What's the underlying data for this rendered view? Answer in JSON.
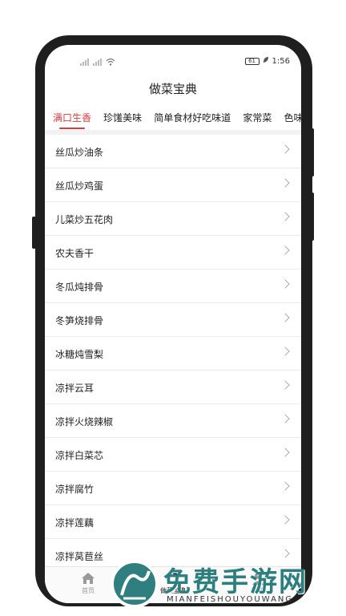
{
  "status": {
    "time": "1:56",
    "battery": "61"
  },
  "header": {
    "title": "做菜宝典"
  },
  "tabs": [
    {
      "label": "满口生香"
    },
    {
      "label": "珍馐美味"
    },
    {
      "label": "简单食材好吃味道"
    },
    {
      "label": "家常菜"
    },
    {
      "label": "色味"
    }
  ],
  "list": [
    {
      "label": "丝瓜炒油条"
    },
    {
      "label": "丝瓜炒鸡蛋"
    },
    {
      "label": "儿菜炒五花肉"
    },
    {
      "label": "农夫香干"
    },
    {
      "label": "冬瓜炖排骨"
    },
    {
      "label": "冬笋烧排骨"
    },
    {
      "label": "冰糖炖雪梨"
    },
    {
      "label": "凉拌云耳"
    },
    {
      "label": "凉拌火烧辣椒"
    },
    {
      "label": "凉拌白菜芯"
    },
    {
      "label": "凉拌腐竹"
    },
    {
      "label": "凉拌莲藕"
    },
    {
      "label": "凉拌莴苣丝"
    }
  ],
  "nav": [
    {
      "label": "首页",
      "icon": "home-icon"
    },
    {
      "label": "做菜宝典",
      "icon": "book-icon"
    },
    {
      "label": "我的",
      "icon": "user-icon"
    }
  ],
  "watermark": {
    "title": "免费手游网",
    "subtitle": "MIANFEISHOUYOUWANG"
  }
}
